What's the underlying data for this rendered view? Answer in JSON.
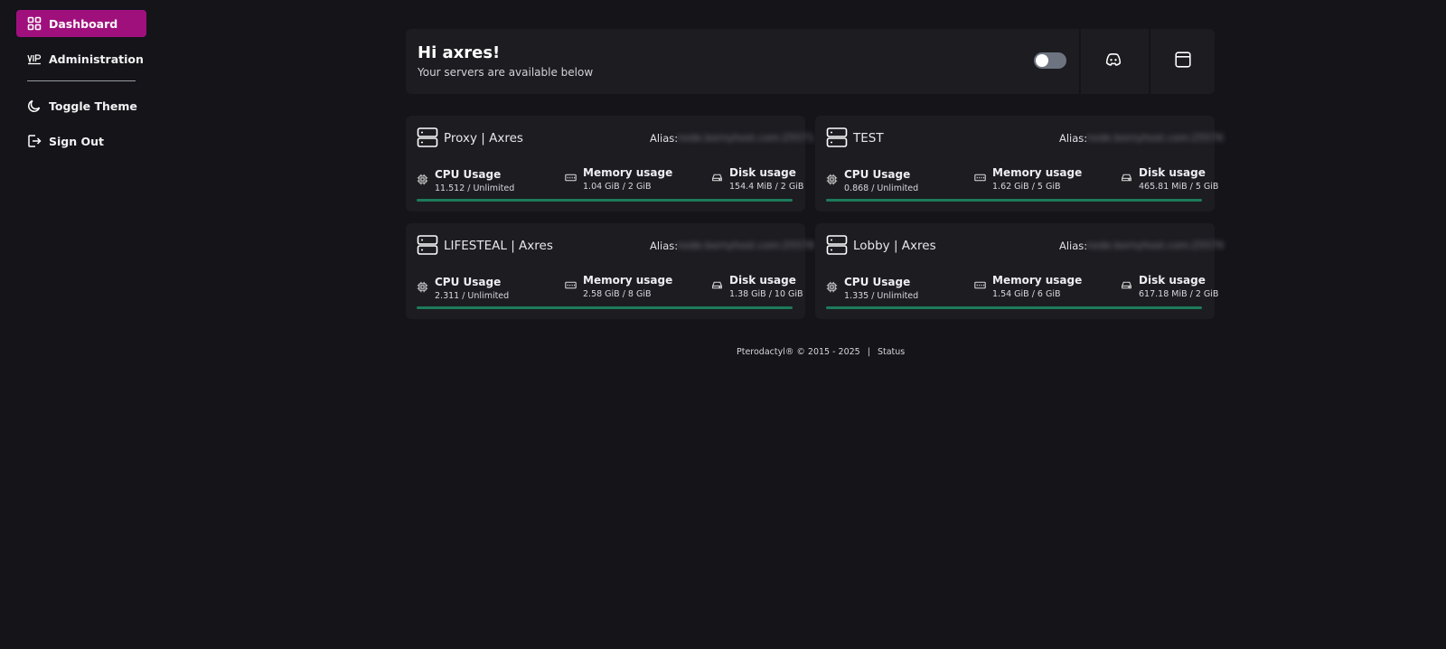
{
  "sidebar": {
    "items": [
      {
        "label": "Dashboard",
        "icon": "grid-icon",
        "active": true
      },
      {
        "label": "Administration",
        "icon": "vip-icon"
      },
      {
        "label": "Toggle Theme",
        "icon": "moon-icon"
      },
      {
        "label": "Sign Out",
        "icon": "sign-out-icon"
      }
    ]
  },
  "header": {
    "greeting": "Hi axres!",
    "subtext": "Your servers are available below",
    "toggle_on": false,
    "buttons": [
      {
        "icon": "discord-icon"
      },
      {
        "icon": "browser-window-icon"
      }
    ]
  },
  "servers": [
    {
      "name": "Proxy | Axres",
      "alias_label": "Alias:",
      "alias_value": "node.bornyhost.com:25571",
      "cpu": {
        "label": "CPU Usage",
        "value": "11.512 / Unlimited"
      },
      "memory": {
        "label": "Memory usage",
        "value": "1.04 GiB / 2 GiB"
      },
      "disk": {
        "label": "Disk usage",
        "value": "154.4 MiB / 2 GiB"
      },
      "progress": 1.0
    },
    {
      "name": "TEST",
      "alias_label": "Alias:",
      "alias_value": "node.bornyhost.com:25576",
      "cpu": {
        "label": "CPU Usage",
        "value": "0.868 / Unlimited"
      },
      "memory": {
        "label": "Memory usage",
        "value": "1.62 GiB / 5 GiB"
      },
      "disk": {
        "label": "Disk usage",
        "value": "465.81 MiB / 5 GiB"
      },
      "progress": 1.0
    },
    {
      "name": "LIFESTEAL | Axres",
      "alias_label": "Alias:",
      "alias_value": "node.bornyhost.com:25578",
      "cpu": {
        "label": "CPU Usage",
        "value": "2.311 / Unlimited"
      },
      "memory": {
        "label": "Memory usage",
        "value": "2.58 GiB / 8 GiB"
      },
      "disk": {
        "label": "Disk usage",
        "value": "1.38 GiB / 10 GiB"
      },
      "progress": 1.0
    },
    {
      "name": "Lobby | Axres",
      "alias_label": "Alias:",
      "alias_value": "node.bornyhost.com:25579",
      "cpu": {
        "label": "CPU Usage",
        "value": "1.335 / Unlimited"
      },
      "memory": {
        "label": "Memory usage",
        "value": "1.54 GiB / 6 GiB"
      },
      "disk": {
        "label": "Disk usage",
        "value": "617.18 MiB / 2 GiB"
      },
      "progress": 1.0
    }
  ],
  "footer": {
    "copyright": "Pterodactyl® © 2015 - 2025",
    "separator": "|",
    "status_link": "Status"
  },
  "colors": {
    "background": "#141419",
    "card": "#1c1c21",
    "accent": "#a0107d",
    "progress": "#1e7a5a"
  }
}
